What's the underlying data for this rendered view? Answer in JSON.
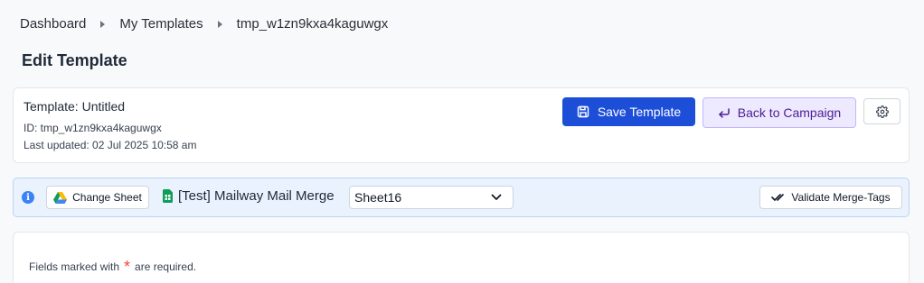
{
  "breadcrumb": {
    "items": [
      "Dashboard",
      "My Templates",
      "tmp_w1zn9kxa4kaguwgx"
    ]
  },
  "page": {
    "title": "Edit Template"
  },
  "template": {
    "name": "Template: Untitled",
    "id_line": "ID: tmp_w1zn9kxa4kaguwgx",
    "updated_line": "Last updated: 02 Jul 2025 10:58 am"
  },
  "actions": {
    "save_label": "Save Template",
    "back_label": "Back to Campaign"
  },
  "sheetbar": {
    "change_label": "Change Sheet",
    "spreadsheet_name": "[Test] Mailway Mail Merge",
    "selected_sheet": "Sheet16",
    "validate_label": "Validate Merge-Tags"
  },
  "form": {
    "required_prefix": "Fields marked with",
    "required_star": "*",
    "required_suffix": "are required."
  },
  "colors": {
    "primary": "#1d4ed8",
    "back_bg": "#ede9fe",
    "back_text": "#4c1d95",
    "info_bg": "#eaf2fd",
    "required": "#ef4444"
  },
  "icons": {
    "save": "floppy-disk-icon",
    "back": "return-arrow-icon",
    "settings": "gear-icon",
    "info": "info-icon",
    "drive": "google-drive-icon",
    "sheets": "google-sheets-icon",
    "dropdown": "chevron-down-icon",
    "validate": "double-check-icon"
  }
}
